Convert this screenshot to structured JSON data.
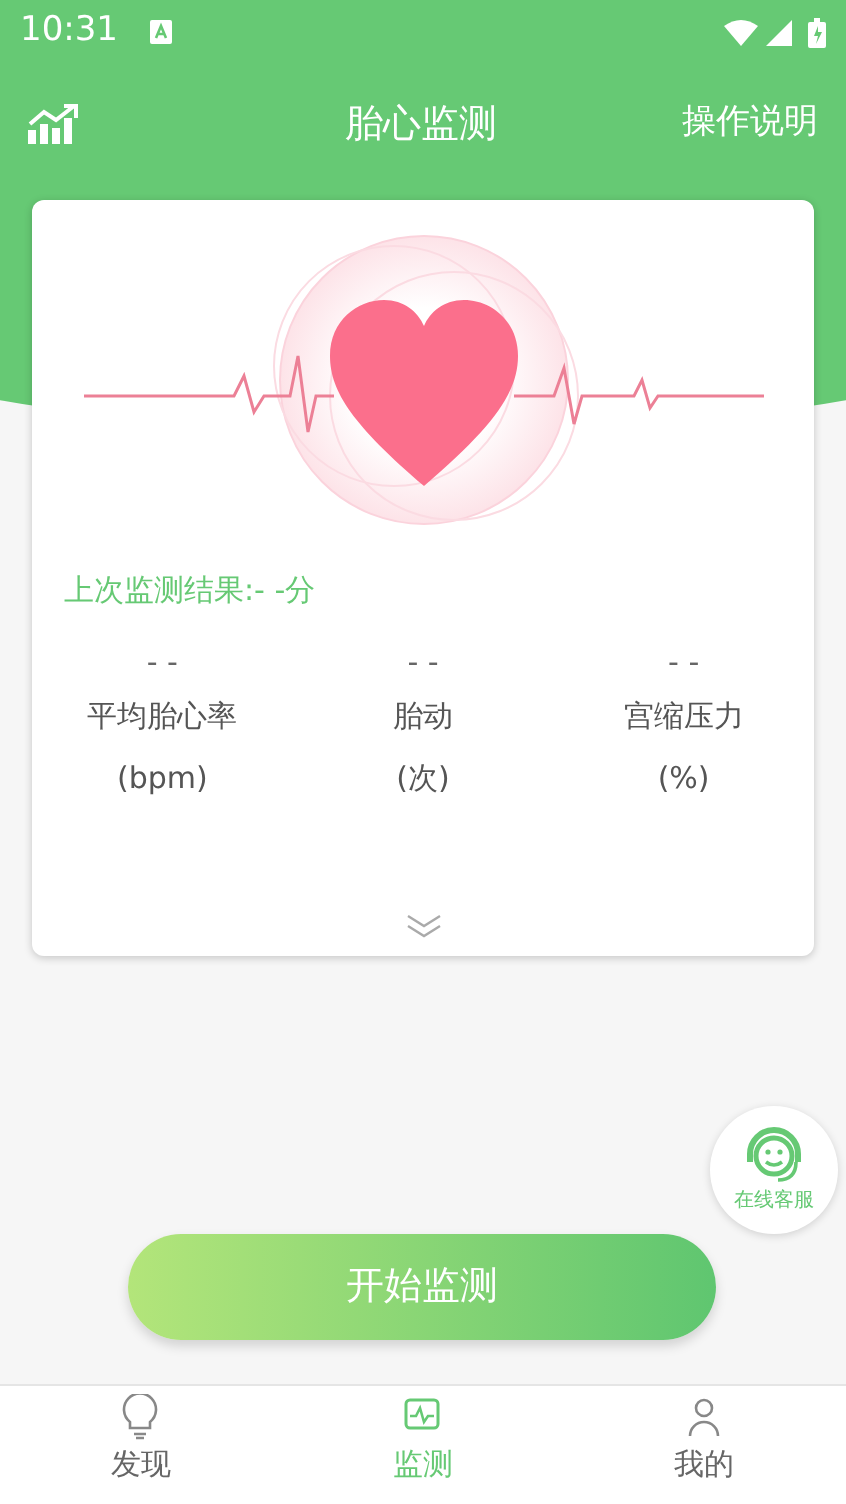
{
  "status_bar": {
    "time": "10:31"
  },
  "header": {
    "title": "胎心监测",
    "action": "操作说明"
  },
  "card": {
    "last_result": "上次监测结果:- -分",
    "stats": [
      {
        "value": "- -",
        "label": "平均胎心率",
        "unit": "(bpm)"
      },
      {
        "value": "- -",
        "label": "胎动",
        "unit": "(次)"
      },
      {
        "value": "- -",
        "label": "宫缩压力",
        "unit": "(%)"
      }
    ]
  },
  "service": {
    "label": "在线客服"
  },
  "start_button": {
    "label": "开始监测"
  },
  "bottom_nav": [
    {
      "label": "发现",
      "kind": "bulb",
      "selected": false
    },
    {
      "label": "监测",
      "kind": "monitor",
      "selected": true
    },
    {
      "label": "我的",
      "kind": "person",
      "selected": false
    }
  ]
}
